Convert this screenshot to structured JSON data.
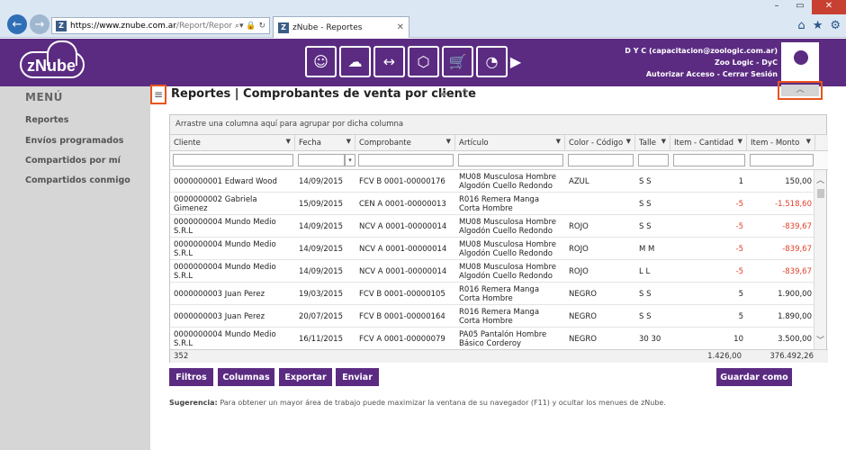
{
  "browser": {
    "url_host": "https://www.znube.com.ar",
    "url_path": "/Report/ReportView?i",
    "tab_title": "zNube - Reportes",
    "favicon_letter": "Z"
  },
  "header": {
    "logo": "zNube",
    "user_line": "D Y C (capacitacion@zoologic.com.ar)",
    "company_line": "Zoo Logic - DyC",
    "links": "Autorizar Acceso - Cerrar Sesión"
  },
  "sidebar": {
    "title": "MENÚ",
    "items": [
      "Reportes",
      "Envíos programados",
      "Compartidos por mí",
      "Compartidos conmigo"
    ]
  },
  "report": {
    "title": "Reportes | Comprobantes de venta por cliente",
    "group_hint": "Arrastre una columna aquí para agrupar por dicha columna"
  },
  "grid": {
    "columns": [
      "Cliente",
      "Fecha",
      "Comprobante",
      "Artículo",
      "Color - Código",
      "Talle",
      "Item - Cantidad",
      "Item - Monto"
    ],
    "rows": [
      [
        "0000000001 Edward Wood",
        "14/09/2015",
        "FCV B 0001-00000176",
        "MU08 Musculosa Hombre Algodón Cuello Redondo",
        "AZUL",
        "S S",
        "1",
        "150,00"
      ],
      [
        "0000000002 Gabriela Gimenez",
        "15/09/2015",
        "CEN A 0001-00000013",
        "R016 Remera Manga Corta Hombre",
        "",
        "S S",
        "-5",
        "-1.518,60"
      ],
      [
        "0000000004 Mundo Medio S.R.L",
        "14/09/2015",
        "NCV A 0001-00000014",
        "MU08 Musculosa Hombre Algodón Cuello Redondo",
        "ROJO",
        "S S",
        "-5",
        "-839,67"
      ],
      [
        "0000000004 Mundo Medio S.R.L",
        "14/09/2015",
        "NCV A 0001-00000014",
        "MU08 Musculosa Hombre Algodón Cuello Redondo",
        "ROJO",
        "M M",
        "-5",
        "-839,67"
      ],
      [
        "0000000004 Mundo Medio S.R.L",
        "14/09/2015",
        "NCV A 0001-00000014",
        "MU08 Musculosa Hombre Algodón Cuello Redondo",
        "ROJO",
        "L L",
        "-5",
        "-839,67"
      ],
      [
        "0000000003 Juan Perez",
        "19/03/2015",
        "FCV B 0001-00000105",
        "R016 Remera Manga Corta Hombre",
        "NEGRO",
        "S S",
        "5",
        "1.900,00"
      ],
      [
        "0000000003 Juan Perez",
        "20/07/2015",
        "FCV B 0001-00000164",
        "R016 Remera Manga Corta Hombre",
        "NEGRO",
        "S S",
        "5",
        "1.890,00"
      ],
      [
        "0000000004 Mundo Medio S.R.L",
        "16/11/2015",
        "FCV A 0001-00000079",
        "PA05 Pantalón Hombre Básico Corderoy",
        "NEGRO",
        "30 30",
        "10",
        "3.500,00"
      ]
    ],
    "footer": {
      "count": "352",
      "total_cantidad": "1.426,00",
      "total_monto": "376.492,26"
    }
  },
  "buttons": {
    "filtros": "Filtros",
    "columnas": "Columnas",
    "exportar": "Exportar",
    "enviar": "Enviar",
    "guardar": "Guardar como"
  },
  "hint": {
    "label": "Sugerencia:",
    "text": "Para obtener un mayor área de trabajo puede maximizar la ventana de su navegador (F11) y ocultar los menues de zNube."
  },
  "colors": {
    "brand": "#5b2b82",
    "highlight": "#e8551e",
    "negative": "#e0402a"
  }
}
